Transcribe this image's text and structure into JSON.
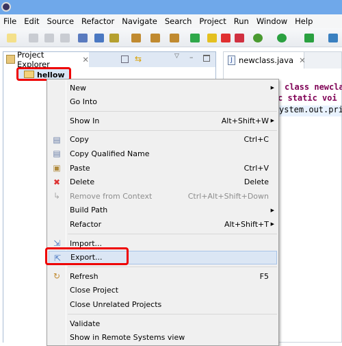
{
  "menubar": [
    "File",
    "Edit",
    "Source",
    "Refactor",
    "Navigate",
    "Search",
    "Project",
    "Run",
    "Window",
    "Help"
  ],
  "left_panel": {
    "tab": "Project Explorer",
    "tree": [
      {
        "label": "hellow",
        "icon": "project-folder-icon"
      }
    ]
  },
  "editor": {
    "tab": "newclass.java",
    "code": [
      "class newcla",
      "c static voi",
      "ystem.out.pri"
    ]
  },
  "context_menu": {
    "items": [
      {
        "label": "New",
        "shortcut": "",
        "submenu": true
      },
      {
        "label": "Go Into",
        "shortcut": ""
      },
      {
        "sep": true
      },
      {
        "label": "Show In",
        "shortcut": "Alt+Shift+W",
        "submenu": true
      },
      {
        "sep": true
      },
      {
        "label": "Copy",
        "shortcut": "Ctrl+C",
        "icon": "copy-icon"
      },
      {
        "label": "Copy Qualified Name",
        "shortcut": "",
        "icon": "copy-qualified-icon"
      },
      {
        "label": "Paste",
        "shortcut": "Ctrl+V",
        "icon": "paste-icon"
      },
      {
        "label": "Delete",
        "shortcut": "Delete",
        "icon": "delete-icon"
      },
      {
        "label": "Remove from Context",
        "shortcut": "Ctrl+Alt+Shift+Down",
        "icon": "remove-context-icon",
        "disabled": true
      },
      {
        "label": "Build Path",
        "shortcut": "",
        "submenu": true
      },
      {
        "label": "Refactor",
        "shortcut": "Alt+Shift+T",
        "submenu": true
      },
      {
        "sep": true
      },
      {
        "label": "Import...",
        "shortcut": "",
        "icon": "import-icon"
      },
      {
        "label": "Export...",
        "shortcut": "",
        "icon": "export-icon",
        "highlighted": true
      },
      {
        "sep": true
      },
      {
        "label": "Refresh",
        "shortcut": "F5",
        "icon": "refresh-icon"
      },
      {
        "label": "Close Project",
        "shortcut": ""
      },
      {
        "label": "Close Unrelated Projects",
        "shortcut": ""
      },
      {
        "sep": true
      },
      {
        "label": "Validate",
        "shortcut": ""
      },
      {
        "label": "Show in Remote Systems view",
        "shortcut": ""
      }
    ]
  },
  "colors": {
    "highlight_box": "#e00000",
    "title_bar": "#6fa8ea",
    "keyword": "#7f0055",
    "field": "#0000c0"
  }
}
